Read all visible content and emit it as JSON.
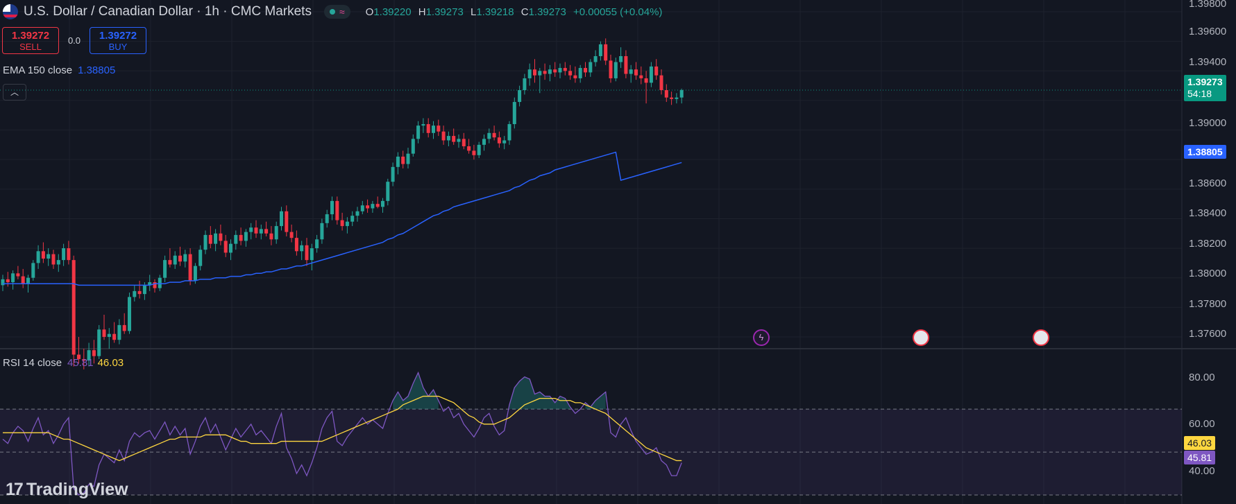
{
  "header": {
    "title": "U.S. Dollar / Canadian Dollar · 1h · CMC Markets",
    "ohlc": {
      "o_label": "O",
      "o": "1.39220",
      "h_label": "H",
      "h": "1.39273",
      "l_label": "L",
      "l": "1.39218",
      "c_label": "C",
      "c": "1.39273",
      "change": "+0.00055 (+0.04%)"
    },
    "status_icon": "wave-icon"
  },
  "trade": {
    "sell_price": "1.39272",
    "sell_label": "SELL",
    "spread": "0.0",
    "buy_price": "1.39272",
    "buy_label": "BUY"
  },
  "ema_legend": {
    "label": "EMA 150 close",
    "value": "1.38805"
  },
  "rsi_legend": {
    "label": "RSI 14 close",
    "rsi_value": "45.81",
    "ma_value": "46.03"
  },
  "price_axis": {
    "ticks": [
      "1.39800",
      "1.39600",
      "1.39400",
      "1.39000",
      "1.38600",
      "1.38400",
      "1.38200",
      "1.38000",
      "1.37800",
      "1.37600"
    ],
    "last_price": "1.39273",
    "countdown": "54:18",
    "ema_badge": "1.38805"
  },
  "rsi_axis": {
    "ticks": [
      "80.00",
      "60.00",
      "40.00"
    ],
    "ma_badge": "46.03",
    "rsi_badge": "45.81"
  },
  "events": [
    {
      "name": "lightning-event-icon"
    },
    {
      "name": "us-flag-event-icon"
    },
    {
      "name": "us-flag-event-icon"
    }
  ],
  "logo": {
    "text": "TradingView",
    "mark": "17"
  },
  "colors": {
    "background": "#131722",
    "up": "#26a69a",
    "down": "#f23645",
    "ema": "#2962ff",
    "rsi": "#7e57c2",
    "rsi_ma": "#ffd740",
    "grid": "#1e222d"
  },
  "chart_data": {
    "type": "candlestick",
    "timeframe": "1h",
    "price_ylim": [
      1.3752,
      1.3988
    ],
    "rsi_ylim": [
      30,
      92
    ],
    "rsi_bands": [
      70,
      50,
      30
    ],
    "candles": [
      [
        1.3795,
        1.3802,
        1.3791,
        1.3799
      ],
      [
        1.3799,
        1.3804,
        1.3794,
        1.3797
      ],
      [
        1.3797,
        1.3805,
        1.3792,
        1.3803
      ],
      [
        1.3803,
        1.3808,
        1.3799,
        1.3801
      ],
      [
        1.3801,
        1.3806,
        1.3793,
        1.3796
      ],
      [
        1.3796,
        1.3802,
        1.379,
        1.38
      ],
      [
        1.38,
        1.3812,
        1.3798,
        1.381
      ],
      [
        1.381,
        1.3822,
        1.3806,
        1.3818
      ],
      [
        1.3818,
        1.3824,
        1.381,
        1.3813
      ],
      [
        1.3813,
        1.382,
        1.3808,
        1.3816
      ],
      [
        1.3816,
        1.3819,
        1.3806,
        1.3809
      ],
      [
        1.3809,
        1.3816,
        1.3804,
        1.3812
      ],
      [
        1.3812,
        1.3823,
        1.3808,
        1.382
      ],
      [
        1.382,
        1.3825,
        1.3809,
        1.3812
      ],
      [
        1.3812,
        1.3815,
        1.374,
        1.3748
      ],
      [
        1.3748,
        1.376,
        1.3742,
        1.3745
      ],
      [
        1.3745,
        1.3752,
        1.3738,
        1.3744
      ],
      [
        1.3744,
        1.3756,
        1.374,
        1.3751
      ],
      [
        1.3751,
        1.3758,
        1.3742,
        1.3747
      ],
      [
        1.3747,
        1.3768,
        1.3745,
        1.3765
      ],
      [
        1.3765,
        1.3775,
        1.3758,
        1.376
      ],
      [
        1.376,
        1.3766,
        1.3752,
        1.3762
      ],
      [
        1.3762,
        1.377,
        1.3756,
        1.3758
      ],
      [
        1.3758,
        1.3772,
        1.3755,
        1.3768
      ],
      [
        1.3768,
        1.3776,
        1.3762,
        1.3764
      ],
      [
        1.3764,
        1.379,
        1.3762,
        1.3787
      ],
      [
        1.3787,
        1.3795,
        1.3784,
        1.3791
      ],
      [
        1.3791,
        1.3798,
        1.3786,
        1.3789
      ],
      [
        1.3789,
        1.3797,
        1.3785,
        1.3795
      ],
      [
        1.3795,
        1.3802,
        1.3791,
        1.3797
      ],
      [
        1.3797,
        1.3799,
        1.379,
        1.3793
      ],
      [
        1.3793,
        1.3802,
        1.3791,
        1.38
      ],
      [
        1.38,
        1.3815,
        1.3797,
        1.3812
      ],
      [
        1.3812,
        1.382,
        1.3807,
        1.3809
      ],
      [
        1.3809,
        1.3818,
        1.3806,
        1.3815
      ],
      [
        1.3815,
        1.3821,
        1.3808,
        1.3811
      ],
      [
        1.3811,
        1.3819,
        1.3807,
        1.3816
      ],
      [
        1.3816,
        1.382,
        1.3795,
        1.3798
      ],
      [
        1.3798,
        1.381,
        1.3796,
        1.3808
      ],
      [
        1.3808,
        1.3822,
        1.3805,
        1.3819
      ],
      [
        1.3819,
        1.3832,
        1.3816,
        1.3829
      ],
      [
        1.3829,
        1.3835,
        1.382,
        1.3823
      ],
      [
        1.3823,
        1.3833,
        1.3818,
        1.383
      ],
      [
        1.383,
        1.3836,
        1.3822,
        1.3825
      ],
      [
        1.3825,
        1.3829,
        1.3814,
        1.3817
      ],
      [
        1.3817,
        1.3826,
        1.3812,
        1.3823
      ],
      [
        1.3823,
        1.3832,
        1.3819,
        1.3829
      ],
      [
        1.3829,
        1.3834,
        1.3822,
        1.3825
      ],
      [
        1.3825,
        1.3833,
        1.3821,
        1.3831
      ],
      [
        1.3831,
        1.3837,
        1.3826,
        1.3834
      ],
      [
        1.3834,
        1.3839,
        1.3827,
        1.383
      ],
      [
        1.383,
        1.3836,
        1.3826,
        1.3833
      ],
      [
        1.3833,
        1.3838,
        1.3828,
        1.383
      ],
      [
        1.383,
        1.3835,
        1.3822,
        1.3826
      ],
      [
        1.3826,
        1.3838,
        1.3823,
        1.3835
      ],
      [
        1.3835,
        1.3848,
        1.3832,
        1.3845
      ],
      [
        1.3845,
        1.3849,
        1.3828,
        1.3831
      ],
      [
        1.3831,
        1.3836,
        1.3824,
        1.3827
      ],
      [
        1.3827,
        1.3832,
        1.3815,
        1.3818
      ],
      [
        1.3818,
        1.3825,
        1.3812,
        1.3822
      ],
      [
        1.3822,
        1.3827,
        1.3808,
        1.3812
      ],
      [
        1.3812,
        1.3823,
        1.3805,
        1.382
      ],
      [
        1.382,
        1.3829,
        1.3817,
        1.3826
      ],
      [
        1.3826,
        1.384,
        1.3823,
        1.3837
      ],
      [
        1.3837,
        1.3846,
        1.3834,
        1.3843
      ],
      [
        1.3843,
        1.3855,
        1.3839,
        1.3852
      ],
      [
        1.3852,
        1.3855,
        1.3836,
        1.3839
      ],
      [
        1.3839,
        1.3844,
        1.3832,
        1.3835
      ],
      [
        1.3835,
        1.3841,
        1.383,
        1.3838
      ],
      [
        1.3838,
        1.3845,
        1.3835,
        1.3842
      ],
      [
        1.3842,
        1.3848,
        1.3838,
        1.3845
      ],
      [
        1.3845,
        1.3852,
        1.3843,
        1.3849
      ],
      [
        1.3849,
        1.3853,
        1.3844,
        1.3847
      ],
      [
        1.3847,
        1.3852,
        1.3844,
        1.385
      ],
      [
        1.385,
        1.3855,
        1.3847,
        1.3848
      ],
      [
        1.3848,
        1.3854,
        1.3844,
        1.3852
      ],
      [
        1.3852,
        1.3867,
        1.3849,
        1.3865
      ],
      [
        1.3865,
        1.3878,
        1.3862,
        1.3875
      ],
      [
        1.3875,
        1.3885,
        1.387,
        1.3882
      ],
      [
        1.3882,
        1.3886,
        1.3874,
        1.3877
      ],
      [
        1.3877,
        1.3888,
        1.3874,
        1.3884
      ],
      [
        1.3884,
        1.3897,
        1.3882,
        1.3894
      ],
      [
        1.3894,
        1.3906,
        1.3891,
        1.3903
      ],
      [
        1.3903,
        1.3908,
        1.3898,
        1.3904
      ],
      [
        1.3904,
        1.3908,
        1.3895,
        1.3898
      ],
      [
        1.3898,
        1.3906,
        1.3894,
        1.3903
      ],
      [
        1.3903,
        1.3907,
        1.3896,
        1.3899
      ],
      [
        1.3899,
        1.3903,
        1.389,
        1.3893
      ],
      [
        1.3893,
        1.3899,
        1.3889,
        1.3896
      ],
      [
        1.3896,
        1.3901,
        1.389,
        1.3892
      ],
      [
        1.3892,
        1.3897,
        1.3888,
        1.3894
      ],
      [
        1.3894,
        1.3898,
        1.3887,
        1.3889
      ],
      [
        1.3889,
        1.3894,
        1.3884,
        1.3886
      ],
      [
        1.3886,
        1.389,
        1.388,
        1.3883
      ],
      [
        1.3883,
        1.3892,
        1.3881,
        1.389
      ],
      [
        1.389,
        1.3897,
        1.3886,
        1.3894
      ],
      [
        1.3894,
        1.3901,
        1.3891,
        1.3898
      ],
      [
        1.3898,
        1.3903,
        1.3893,
        1.3895
      ],
      [
        1.3895,
        1.3899,
        1.3888,
        1.3891
      ],
      [
        1.3891,
        1.3896,
        1.3887,
        1.3893
      ],
      [
        1.3893,
        1.3906,
        1.389,
        1.3904
      ],
      [
        1.3904,
        1.3922,
        1.3901,
        1.3919
      ],
      [
        1.3919,
        1.393,
        1.3916,
        1.3927
      ],
      [
        1.3927,
        1.3938,
        1.3924,
        1.3935
      ],
      [
        1.3935,
        1.3945,
        1.393,
        1.3941
      ],
      [
        1.3941,
        1.3948,
        1.3932,
        1.3937
      ],
      [
        1.3937,
        1.3942,
        1.3925,
        1.394
      ],
      [
        1.394,
        1.3945,
        1.3934,
        1.3938
      ],
      [
        1.3938,
        1.3944,
        1.3933,
        1.3941
      ],
      [
        1.3941,
        1.3946,
        1.3936,
        1.3939
      ],
      [
        1.3939,
        1.3945,
        1.3935,
        1.3942
      ],
      [
        1.3942,
        1.3946,
        1.3937,
        1.394
      ],
      [
        1.394,
        1.3944,
        1.3934,
        1.3937
      ],
      [
        1.3937,
        1.3943,
        1.3932,
        1.3935
      ],
      [
        1.3935,
        1.3944,
        1.3932,
        1.3942
      ],
      [
        1.3942,
        1.3946,
        1.3936,
        1.3939
      ],
      [
        1.3939,
        1.3948,
        1.3936,
        1.3946
      ],
      [
        1.3946,
        1.3954,
        1.3943,
        1.395
      ],
      [
        1.395,
        1.396,
        1.3947,
        1.3958
      ],
      [
        1.3958,
        1.3962,
        1.3944,
        1.3947
      ],
      [
        1.3947,
        1.3951,
        1.3932,
        1.3935
      ],
      [
        1.3935,
        1.3949,
        1.3933,
        1.3946
      ],
      [
        1.3946,
        1.3956,
        1.3942,
        1.395
      ],
      [
        1.395,
        1.3954,
        1.3935,
        1.3938
      ],
      [
        1.3938,
        1.3944,
        1.3932,
        1.3941
      ],
      [
        1.3941,
        1.3946,
        1.3934,
        1.3937
      ],
      [
        1.3937,
        1.3943,
        1.3931,
        1.3935
      ],
      [
        1.3935,
        1.394,
        1.3918,
        1.3932
      ],
      [
        1.3932,
        1.3946,
        1.3929,
        1.3943
      ],
      [
        1.3943,
        1.3948,
        1.3934,
        1.3937
      ],
      [
        1.3937,
        1.3941,
        1.3924,
        1.3927
      ],
      [
        1.3927,
        1.3931,
        1.3919,
        1.3922
      ],
      [
        1.3922,
        1.3926,
        1.3917,
        1.3921
      ],
      [
        1.3921,
        1.3925,
        1.3918,
        1.3922
      ],
      [
        1.3922,
        1.3928,
        1.3918,
        1.3927
      ]
    ],
    "ema": [
      1.3796,
      1.3796,
      1.3796,
      1.3796,
      1.3796,
      1.3796,
      1.3796,
      1.3796,
      1.3796,
      1.3796,
      1.3796,
      1.3796,
      1.3796,
      1.3796,
      1.3796,
      1.3795,
      1.3795,
      1.3795,
      1.3795,
      1.3795,
      1.3795,
      1.3795,
      1.3795,
      1.3795,
      1.3795,
      1.3795,
      1.3795,
      1.3795,
      1.3795,
      1.3795,
      1.3796,
      1.3796,
      1.3796,
      1.3797,
      1.3797,
      1.3797,
      1.3798,
      1.3798,
      1.3798,
      1.3799,
      1.3799,
      1.3799,
      1.38,
      1.38,
      1.38,
      1.3801,
      1.3801,
      1.3801,
      1.3802,
      1.3802,
      1.3803,
      1.3803,
      1.3804,
      1.3804,
      1.3805,
      1.3806,
      1.3806,
      1.3807,
      1.3808,
      1.3808,
      1.3809,
      1.381,
      1.3811,
      1.3812,
      1.3813,
      1.3814,
      1.3815,
      1.3816,
      1.3817,
      1.3818,
      1.3819,
      1.382,
      1.3821,
      1.3822,
      1.3823,
      1.3824,
      1.3826,
      1.3827,
      1.3829,
      1.383,
      1.3832,
      1.3834,
      1.3836,
      1.3838,
      1.384,
      1.3842,
      1.3843,
      1.3845,
      1.3846,
      1.3848,
      1.3849,
      1.385,
      1.3851,
      1.3852,
      1.3853,
      1.3854,
      1.3855,
      1.3856,
      1.3857,
      1.3858,
      1.3859,
      1.3861,
      1.3862,
      1.3864,
      1.3866,
      1.3867,
      1.3869,
      1.387,
      1.3871,
      1.3873,
      1.3874,
      1.3875,
      1.3876,
      1.3877,
      1.3878,
      1.3879,
      1.388,
      1.3881,
      1.3882,
      1.3883,
      1.3884,
      1.3885,
      1.3866,
      1.3867,
      1.3868,
      1.3869,
      1.387,
      1.3871,
      1.3872,
      1.3873,
      1.3874,
      1.3875,
      1.3876,
      1.3877,
      1.3878
    ],
    "rsi": [
      56,
      54,
      59,
      62,
      60,
      55,
      61,
      66,
      58,
      60,
      54,
      58,
      63,
      66,
      33,
      30,
      31,
      35,
      34,
      44,
      49,
      47,
      45,
      51,
      46,
      55,
      59,
      57,
      59,
      60,
      56,
      60,
      64,
      58,
      62,
      58,
      61,
      49,
      55,
      62,
      66,
      59,
      63,
      57,
      51,
      56,
      61,
      57,
      60,
      63,
      58,
      60,
      57,
      54,
      62,
      68,
      52,
      47,
      40,
      44,
      39,
      45,
      52,
      61,
      66,
      69,
      55,
      53,
      57,
      60,
      63,
      66,
      63,
      65,
      63,
      61,
      68,
      74,
      78,
      74,
      76,
      82,
      87,
      80,
      76,
      79,
      74,
      69,
      71,
      66,
      68,
      63,
      60,
      57,
      61,
      66,
      68,
      62,
      58,
      60,
      72,
      80,
      83,
      85,
      84,
      77,
      78,
      76,
      76,
      73,
      76,
      75,
      71,
      68,
      70,
      73,
      71,
      74,
      76,
      78,
      59,
      57,
      63,
      66,
      60,
      55,
      52,
      49,
      50,
      52,
      46,
      44,
      39,
      39,
      45
    ],
    "rsi_ma": [
      59,
      59,
      59,
      59,
      59,
      59,
      59,
      59,
      59,
      59,
      58,
      57,
      56,
      56,
      55,
      54,
      53,
      52,
      51,
      50,
      49,
      48,
      47,
      46,
      47,
      48,
      49,
      50,
      51,
      52,
      53,
      54,
      55,
      56,
      56,
      57,
      57,
      57,
      57,
      57,
      58,
      58,
      58,
      58,
      58,
      57,
      56,
      55,
      55,
      54,
      54,
      54,
      54,
      54,
      54,
      55,
      55,
      55,
      55,
      55,
      55,
      55,
      55,
      55,
      56,
      57,
      58,
      59,
      60,
      61,
      62,
      63,
      64,
      65,
      66,
      67,
      68,
      69,
      70,
      72,
      73,
      74,
      75,
      76,
      76,
      76,
      76,
      75,
      74,
      73,
      71,
      69,
      67,
      66,
      64,
      63,
      63,
      63,
      64,
      65,
      66,
      68,
      70,
      72,
      73,
      74,
      75,
      75,
      75,
      75,
      74,
      74,
      74,
      73,
      73,
      72,
      71,
      70,
      69,
      68,
      66,
      64,
      62,
      60,
      58,
      56,
      54,
      52,
      51,
      50,
      49,
      48,
      47,
      46,
      46
    ]
  }
}
